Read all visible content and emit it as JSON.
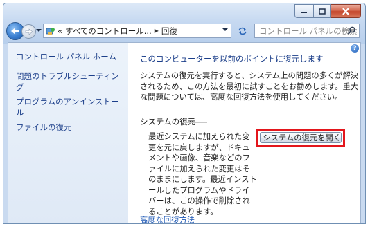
{
  "address": {
    "overflow": "«",
    "breadcrumb_1": "すべてのコントロール...",
    "breadcrumb_2": "回復"
  },
  "search": {
    "placeholder": "コントロール パネルの検索"
  },
  "sidebar": {
    "items": [
      {
        "label": "コントロール パネル ホーム"
      },
      {
        "label": "問題のトラブルシューティング"
      },
      {
        "label": "プログラムのアンインストール"
      },
      {
        "label": "ファイルの復元"
      }
    ]
  },
  "main": {
    "heading": "このコンピューターを以前のポイントに復元します",
    "description": "システムの復元を実行すると、システム上の問題の多くが解決されるため、この方法を最初に試すことをお勧めします。重大な問題については、高度な回復方法を使用してください。",
    "group_title": "システムの復元",
    "group_text": "最近システムに加えられた変更を元に戻しますが、ドキュメントや画像、音楽などのファイルに加えられた変更はそのままにします。最近インストールしたプログラムやドライバーは、この操作で削除されることがあります。",
    "open_button": "システムの復元を開く",
    "advanced_link": "高度な回復方法"
  },
  "colors": {
    "highlight": "#e3161c",
    "link": "#1c3f8a",
    "sidebar_bg": "#e6eef8"
  }
}
